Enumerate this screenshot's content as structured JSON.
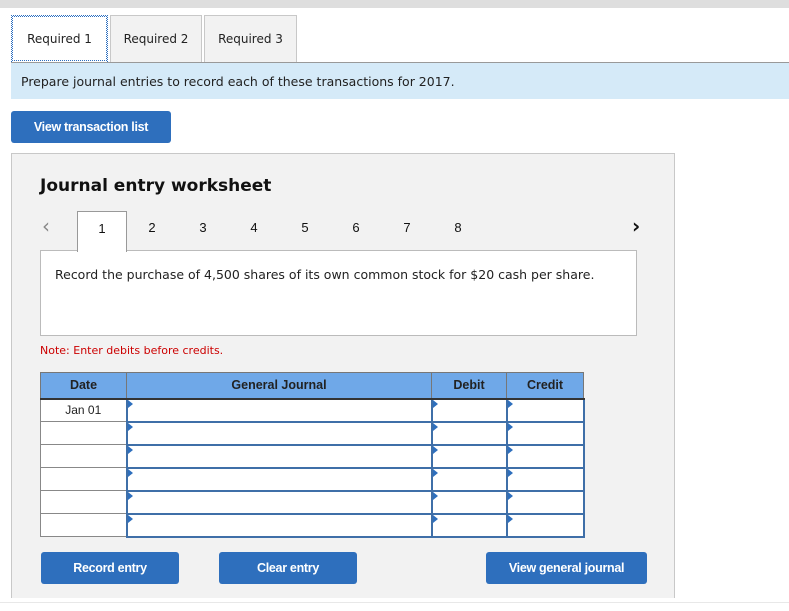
{
  "tabs": [
    {
      "label": "Required 1",
      "active": true
    },
    {
      "label": "Required 2",
      "active": false
    },
    {
      "label": "Required 3",
      "active": false
    }
  ],
  "instruction": "Prepare journal entries to record each of these transactions for 2017.",
  "buttons": {
    "view_transaction_list": "View transaction list",
    "record_entry": "Record entry",
    "clear_entry": "Clear entry",
    "view_general_journal": "View general journal"
  },
  "worksheet": {
    "title": "Journal entry worksheet",
    "pager": {
      "prev_icon": "‹",
      "next_icon": "›",
      "pages": [
        "1",
        "2",
        "3",
        "4",
        "5",
        "6",
        "7",
        "8"
      ],
      "current": "1"
    },
    "description": "Record the purchase of 4,500 shares of its own common stock for $20 cash per share.",
    "note": "Note: Enter debits before credits."
  },
  "table": {
    "headers": [
      "Date",
      "General Journal",
      "Debit",
      "Credit"
    ],
    "rows": [
      {
        "date": "Jan 01",
        "account": "",
        "debit": "",
        "credit": ""
      },
      {
        "date": "",
        "account": "",
        "debit": "",
        "credit": ""
      },
      {
        "date": "",
        "account": "",
        "debit": "",
        "credit": ""
      },
      {
        "date": "",
        "account": "",
        "debit": "",
        "credit": ""
      },
      {
        "date": "",
        "account": "",
        "debit": "",
        "credit": ""
      },
      {
        "date": "",
        "account": "",
        "debit": "",
        "credit": ""
      }
    ]
  }
}
